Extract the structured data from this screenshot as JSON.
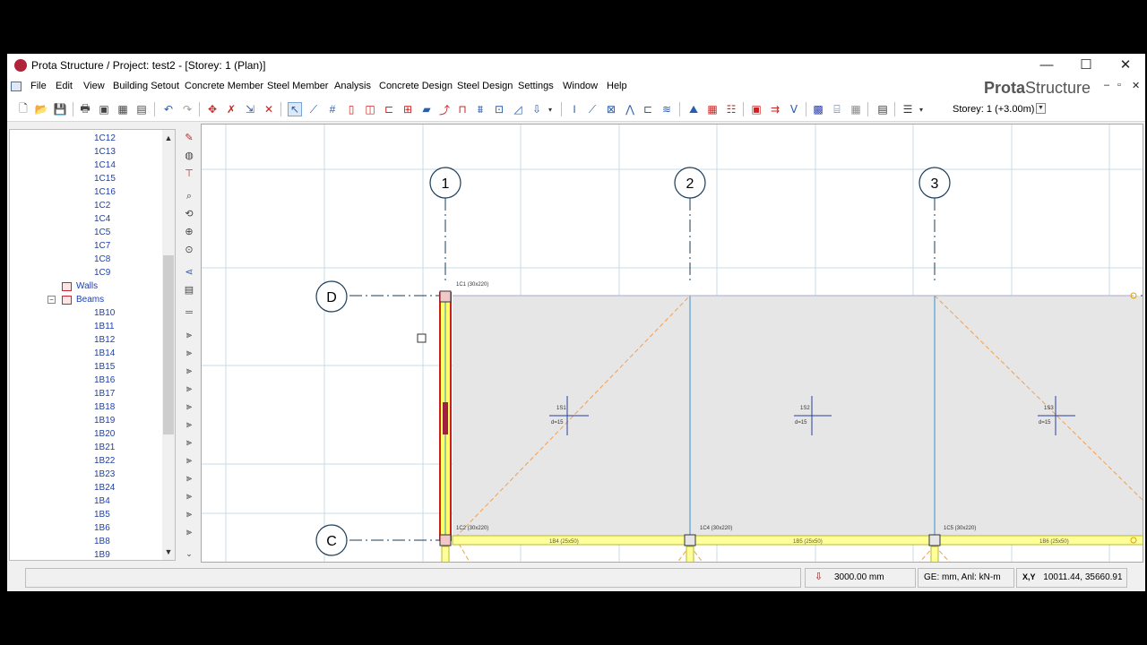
{
  "window": {
    "title": "Prota Structure / Project: test2 - [Storey: 1 (Plan)]",
    "controls": {
      "minimize": "—",
      "maximize": "☐",
      "close": "✕"
    }
  },
  "menu": [
    "File",
    "Edit",
    "View",
    "Building Setout",
    "Concrete Member",
    "Steel Member",
    "Analysis",
    "Concrete Design",
    "Steel Design",
    "Settings",
    "Window",
    "Help"
  ],
  "brand": {
    "bold": "Prota",
    "regular": "Structure"
  },
  "mdi_controls": {
    "minimize": "–",
    "restore": "▫",
    "close": "✕"
  },
  "toolbar": {
    "storey": "Storey: 1 (+3.00m)"
  },
  "tree": {
    "columns": [
      "1C12",
      "1C13",
      "1C14",
      "1C15",
      "1C16",
      "1C2",
      "1C4",
      "1C5",
      "1C7",
      "1C8",
      "1C9"
    ],
    "walls_label": "Walls",
    "beams_label": "Beams",
    "beams": [
      "1B10",
      "1B11",
      "1B12",
      "1B14",
      "1B15",
      "1B16",
      "1B17",
      "1B18",
      "1B19",
      "1B20",
      "1B21",
      "1B22",
      "1B23",
      "1B24",
      "1B4",
      "1B5",
      "1B6",
      "1B8",
      "1B9"
    ]
  },
  "drawing": {
    "axes_vertical": [
      "1",
      "2",
      "3"
    ],
    "axes_horizontal": [
      "D",
      "C"
    ],
    "column_labels": {
      "c1": "1C1 (30x220)",
      "c2": "1C2 (30x220)",
      "c4": "1C4 (30x220)",
      "c5": "1C5 (30x220)"
    },
    "slab_labels": [
      {
        "name": "1S1",
        "value": "d=15"
      },
      {
        "name": "1S2",
        "value": "d=15"
      },
      {
        "name": "1S3",
        "value": "d=15"
      }
    ],
    "beam_labels": [
      "1B4 (25x50)",
      "1B5 (25x50)",
      "1B6 (25x50)"
    ],
    "colors": {
      "axis": "#1a3c5a",
      "grid": "#c8dbe4",
      "slab": "#e6e6e6",
      "beam": "#ffff99",
      "column": "#cc2020",
      "diagonal": "#f0a050"
    }
  },
  "status": {
    "elevation": "3000.00 mm",
    "units": "GE: mm,  Anl: kN-m",
    "coords_label": "X,Y",
    "coords": "10011.44, 35660.91"
  }
}
